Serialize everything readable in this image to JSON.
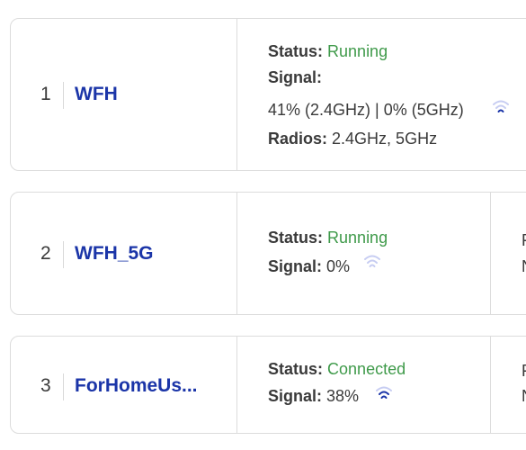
{
  "networks": [
    {
      "index": "1",
      "name": "WFH",
      "status_label": "Status:",
      "status_value": "Running",
      "signal_label": "Signal:",
      "signal_value": "41% (2.4GHz) | 0% (5GHz)",
      "radios_label": "Radios:",
      "radios_value": "2.4GHz, 5GHz",
      "signal_level": 0.41,
      "icon": "wifi-icon"
    },
    {
      "index": "2",
      "name": "WFH_5G",
      "status_label": "Status:",
      "status_value": "Running",
      "signal_label": "Signal:",
      "signal_value": "0%",
      "signal_level": 0.0,
      "icon": "wifi-icon",
      "cut_col_lines": [
        "F",
        "N"
      ]
    },
    {
      "index": "3",
      "name": "ForHomeUs...",
      "status_label": "Status:",
      "status_value": "Connected",
      "signal_label": "Signal:",
      "signal_value": "38%",
      "signal_level": 0.38,
      "icon": "wifi-icon",
      "cut_col_lines": [
        "F",
        "N"
      ]
    }
  ],
  "colors": {
    "name": "#1b35a8",
    "status_ok": "#3f9a4a",
    "wifi_active": "#1b35a8",
    "wifi_inactive": "#c7cdf2"
  }
}
